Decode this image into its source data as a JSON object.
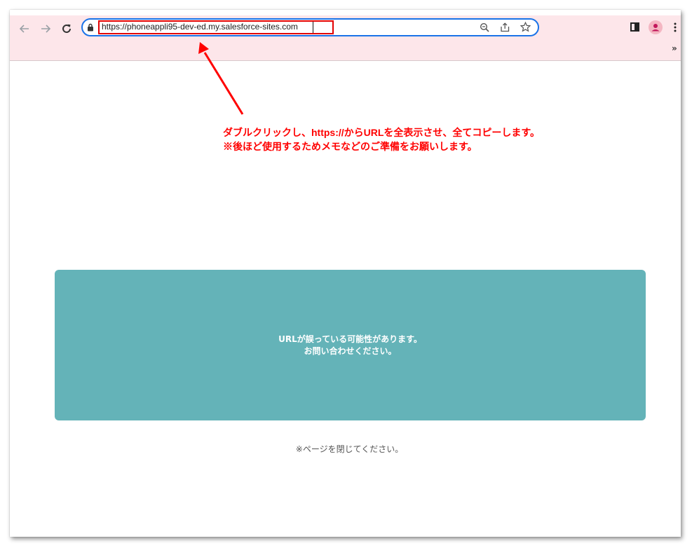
{
  "browser": {
    "url": "https://phoneappli95-dev-ed.my.salesforce-sites.com",
    "extensions_overflow": "»"
  },
  "annotation": {
    "line1": "ダブルクリックし、https://からURLを全表示させ、全てコピーします。",
    "line2": "※後ほど使用するためメモなどのご準備をお願いします。",
    "color": "#ff0000"
  },
  "page": {
    "error_line1": "URLが誤っている可能性があります。",
    "error_line2": "お問い合わせください。",
    "close_note": "※ページを閉じてください。",
    "card_color": "#64b3b8"
  }
}
